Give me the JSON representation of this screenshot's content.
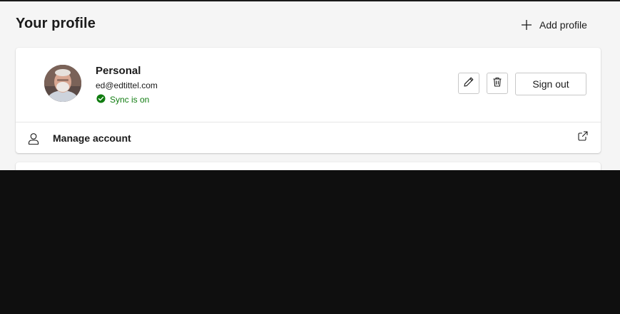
{
  "header": {
    "title": "Your profile",
    "add_profile_label": "Add profile",
    "add_icon": "plus-icon"
  },
  "profile": {
    "name": "Personal",
    "email": "ed@edtittel.com",
    "sync_status": "Sync is on",
    "sync_icon": "check-circle-icon",
    "avatar": "profile-photo",
    "edit_icon": "pencil-icon",
    "delete_icon": "trash-icon",
    "sign_out_label": "Sign out"
  },
  "manage": {
    "label": "Manage account",
    "icon": "person-icon",
    "trailing_icon": "external-link-icon"
  },
  "colors": {
    "page_background": "#f5f5f5",
    "card_background": "#ffffff",
    "sync_green": "#107c10",
    "text": "#1b1b1b"
  }
}
